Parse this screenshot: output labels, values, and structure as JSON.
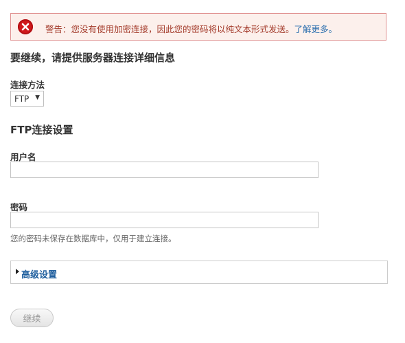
{
  "warning": {
    "icon": "error-icon",
    "message": "警告：您没有使用加密连接，因此您的密码将以纯文本形式发送。",
    "link_label": "了解更多。"
  },
  "heading": "要继续，请提供服务器连接详细信息",
  "connection_method": {
    "label": "连接方法",
    "selected": "FTP"
  },
  "ftp_section": {
    "heading": "FTP连接设置",
    "username_label": "用户名",
    "username_value": "",
    "password_label": "密码",
    "password_value": "",
    "password_help": "您的密码未保存在数据库中，仅用于建立连接。"
  },
  "advanced": {
    "label": "高级设置",
    "icon": "triangle-right-icon"
  },
  "submit_label": "继续"
}
